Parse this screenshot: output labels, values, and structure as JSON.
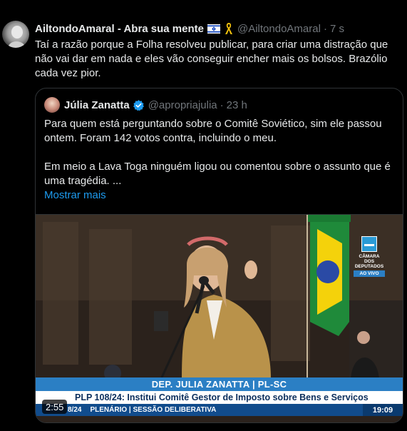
{
  "tweet": {
    "author_name": "AiltondoAmaral - Abra sua mente",
    "handle": "@AiltondoAmaral",
    "separator": "·",
    "time": "7 s",
    "text": "Taí a razão porque a Folha resolveu publicar, para criar uma distração que não vai dar em nada e eles vão conseguir encher mais os bolsos. Brazólio cada vez pior."
  },
  "quote": {
    "author_name": "Júlia Zanatta",
    "handle": "@apropriajulia",
    "separator": "·",
    "time": "23 h",
    "paragraph1": "Para quem está perguntando sobre o Comitê Soviético, sim ele passou ontem. Foram 142 votos contra, incluindo o meu.",
    "paragraph2": "Em meio a Lava Toga ninguém ligou ou comentou sobre o assunto que é uma tragédia. ...",
    "show_more": "Mostrar mais"
  },
  "video": {
    "duration": "2:55",
    "broadcaster_line1": "CÂMARA DOS",
    "broadcaster_line2": "DEPUTADOS",
    "broadcaster_live": "AO VIVO",
    "lower_third_name": "DEP. JULIA ZANATTA | PL-SC",
    "lower_third_title": "PLP 108/24: Institui Comitê Gestor de Imposto sobre Bens e Serviços",
    "ticker_left": "8/24",
    "ticker_right": "PLENÁRIO | SESSÃO DELIBERATIVA",
    "ticker_time": "19:09"
  },
  "icons": {
    "flag": "israel-flag-icon",
    "ribbon": "yellow-ribbon-icon",
    "verified": "verified-badge-icon"
  },
  "colors": {
    "background": "#000000",
    "text": "#e7e9ea",
    "muted": "#71767b",
    "link": "#1d9bf0",
    "verified": "#1d9bf0"
  }
}
